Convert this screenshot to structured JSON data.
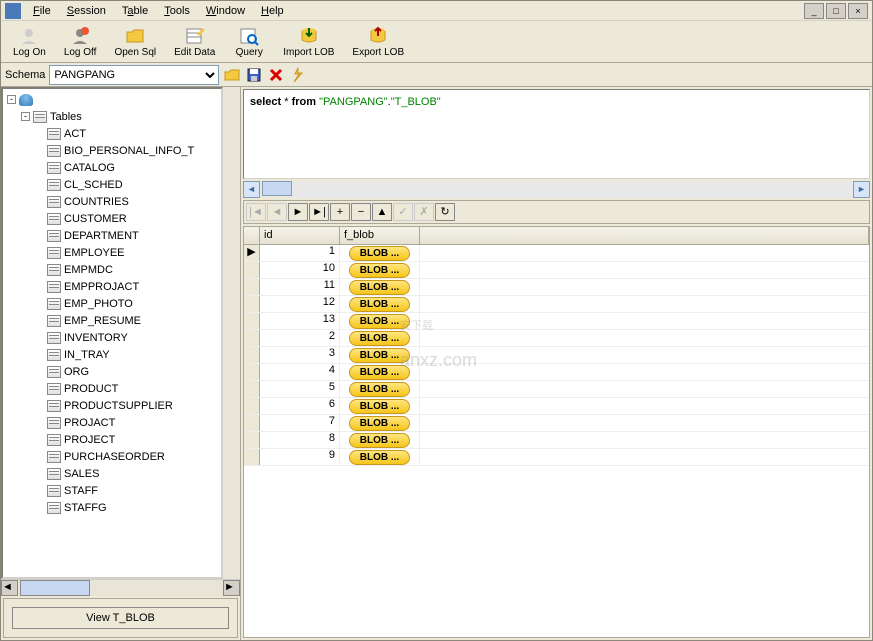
{
  "menu": {
    "file": "File",
    "session": "Session",
    "table": "Table",
    "tools": "Tools",
    "window": "Window",
    "help": "Help"
  },
  "toolbar": {
    "logon": "Log On",
    "logoff": "Log Off",
    "opensql": "Open Sql",
    "editdata": "Edit Data",
    "query": "Query",
    "importlob": "Import LOB",
    "exportlob": "Export LOB"
  },
  "schema": {
    "label": "Schema",
    "value": "PANGPANG"
  },
  "tree": {
    "root": "Tables",
    "items": [
      "ACT",
      "BIO_PERSONAL_INFO_T",
      "CATALOG",
      "CL_SCHED",
      "COUNTRIES",
      "CUSTOMER",
      "DEPARTMENT",
      "EMPLOYEE",
      "EMPMDC",
      "EMPPROJACT",
      "EMP_PHOTO",
      "EMP_RESUME",
      "INVENTORY",
      "IN_TRAY",
      "ORG",
      "PRODUCT",
      "PRODUCTSUPPLIER",
      "PROJACT",
      "PROJECT",
      "PURCHASEORDER",
      "SALES",
      "STAFF",
      "STAFFG"
    ]
  },
  "viewbtn": "View T_BLOB",
  "sql": {
    "s1": "select",
    "s2": " * ",
    "s3": "from",
    "s4": " ",
    "s5": "\"PANGPANG\"",
    "s6": ".",
    "s7": "\"T_BLOB\""
  },
  "grid": {
    "cols": {
      "id": "id",
      "fblob": "f_blob"
    },
    "rows": [
      {
        "id": "1",
        "blob": "BLOB ..."
      },
      {
        "id": "10",
        "blob": "BLOB ..."
      },
      {
        "id": "11",
        "blob": "BLOB ..."
      },
      {
        "id": "12",
        "blob": "BLOB ..."
      },
      {
        "id": "13",
        "blob": "BLOB ..."
      },
      {
        "id": "2",
        "blob": "BLOB ..."
      },
      {
        "id": "3",
        "blob": "BLOB ..."
      },
      {
        "id": "4",
        "blob": "BLOB ..."
      },
      {
        "id": "5",
        "blob": "BLOB ..."
      },
      {
        "id": "6",
        "blob": "BLOB ..."
      },
      {
        "id": "7",
        "blob": "BLOB ..."
      },
      {
        "id": "8",
        "blob": "BLOB ..."
      },
      {
        "id": "9",
        "blob": "BLOB ..."
      }
    ]
  },
  "watermark": {
    "big": "安下载",
    "small": "anxz.com"
  }
}
